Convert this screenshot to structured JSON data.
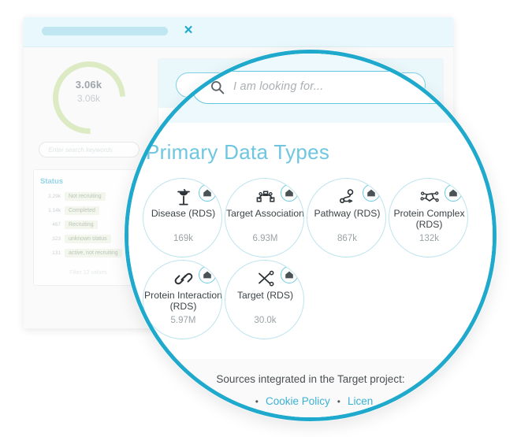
{
  "window": {
    "tab_placeholder": "",
    "close_label": "×"
  },
  "background_app": {
    "gauge": {
      "value_primary": "3.06k",
      "value_secondary": "3.06k"
    },
    "search_placeholder": "Enter search keywords",
    "facet": {
      "title": "Status",
      "rows": [
        {
          "count": "2.29k",
          "label": "Not recruiting"
        },
        {
          "count": "1.14k",
          "label": "Completed"
        },
        {
          "count": "467",
          "label": "Recruiting"
        },
        {
          "count": "323",
          "label": "unknown status"
        },
        {
          "count": "131",
          "label": "active, not recruiting"
        }
      ],
      "more_label": "Filter 12 values"
    }
  },
  "magnifier": {
    "search": {
      "placeholder": "I am looking for...",
      "icon": "search-icon",
      "value": ""
    },
    "section_title": "Primary Data Types",
    "tiles": [
      {
        "label": "Disease (RDS)",
        "count": "169k",
        "icon": "rod-of-asclepius-icon",
        "badge_icon": "home-icon"
      },
      {
        "label": "Target Association",
        "count": "6.93M",
        "icon": "network-graph-icon",
        "badge_icon": "home-icon"
      },
      {
        "label": "Pathway (RDS)",
        "count": "867k",
        "icon": "pathway-icon",
        "badge_icon": "home-icon"
      },
      {
        "label": "Protein Complex (RDS)",
        "count": "132k",
        "icon": "molecule-icon",
        "badge_icon": "home-icon"
      },
      {
        "label": "Protein Interaction (RDS)",
        "count": "5.97M",
        "icon": "link-chain-icon",
        "badge_icon": "home-icon"
      },
      {
        "label": "Target (RDS)",
        "count": "30.0k",
        "icon": "scissors-icon",
        "badge_icon": "home-icon"
      }
    ],
    "footer": {
      "sources_text": "Sources integrated in the Target project:",
      "links": [
        "Cookie Policy",
        "Licen"
      ],
      "bullet": "•"
    }
  },
  "colors": {
    "magnifier_ring": "#1fa9cc",
    "accent_cyan": "#6ec6e0",
    "link_blue": "#3ab2d4",
    "tile_border": "#bfe4f0",
    "gauge_green": "#d6e8b8"
  }
}
